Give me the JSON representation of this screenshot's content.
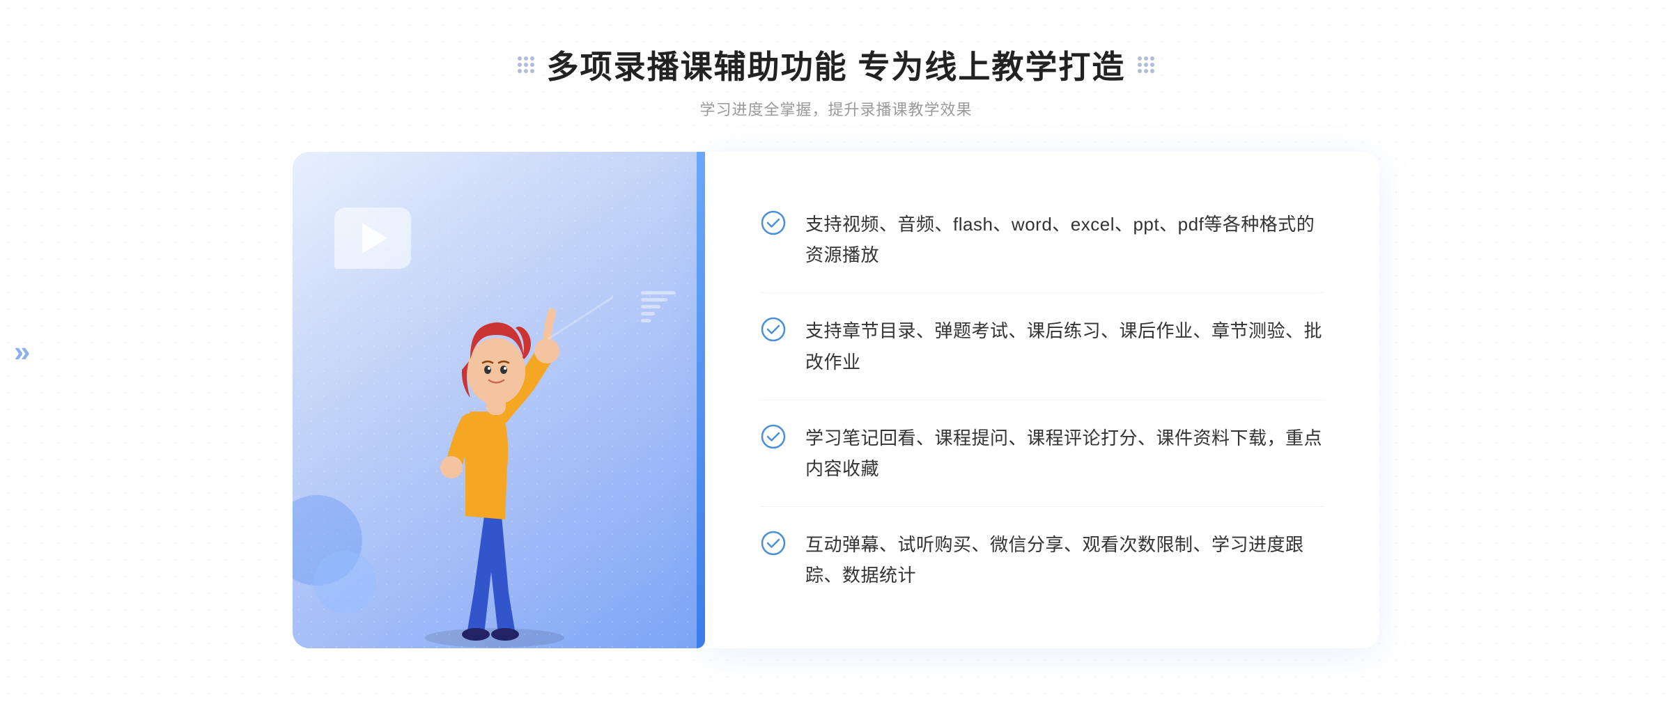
{
  "header": {
    "title": "多项录播课辅助功能 专为线上教学打造",
    "subtitle": "学习进度全掌握，提升录播课教学效果"
  },
  "features": [
    {
      "id": "feature-1",
      "text": "支持视频、音频、flash、word、excel、ppt、pdf等各种格式的资源播放"
    },
    {
      "id": "feature-2",
      "text": "支持章节目录、弹题考试、课后练习、课后作业、章节测验、批改作业"
    },
    {
      "id": "feature-3",
      "text": "学习笔记回看、课程提问、课程评论打分、课件资料下载，重点内容收藏"
    },
    {
      "id": "feature-4",
      "text": "互动弹幕、试听购买、微信分享、观看次数限制、学习进度跟踪、数据统计"
    }
  ],
  "icons": {
    "check_color": "#4a90d9",
    "title_dots_color": "#b0bcd8",
    "accent_blue": "#3a7ded"
  }
}
